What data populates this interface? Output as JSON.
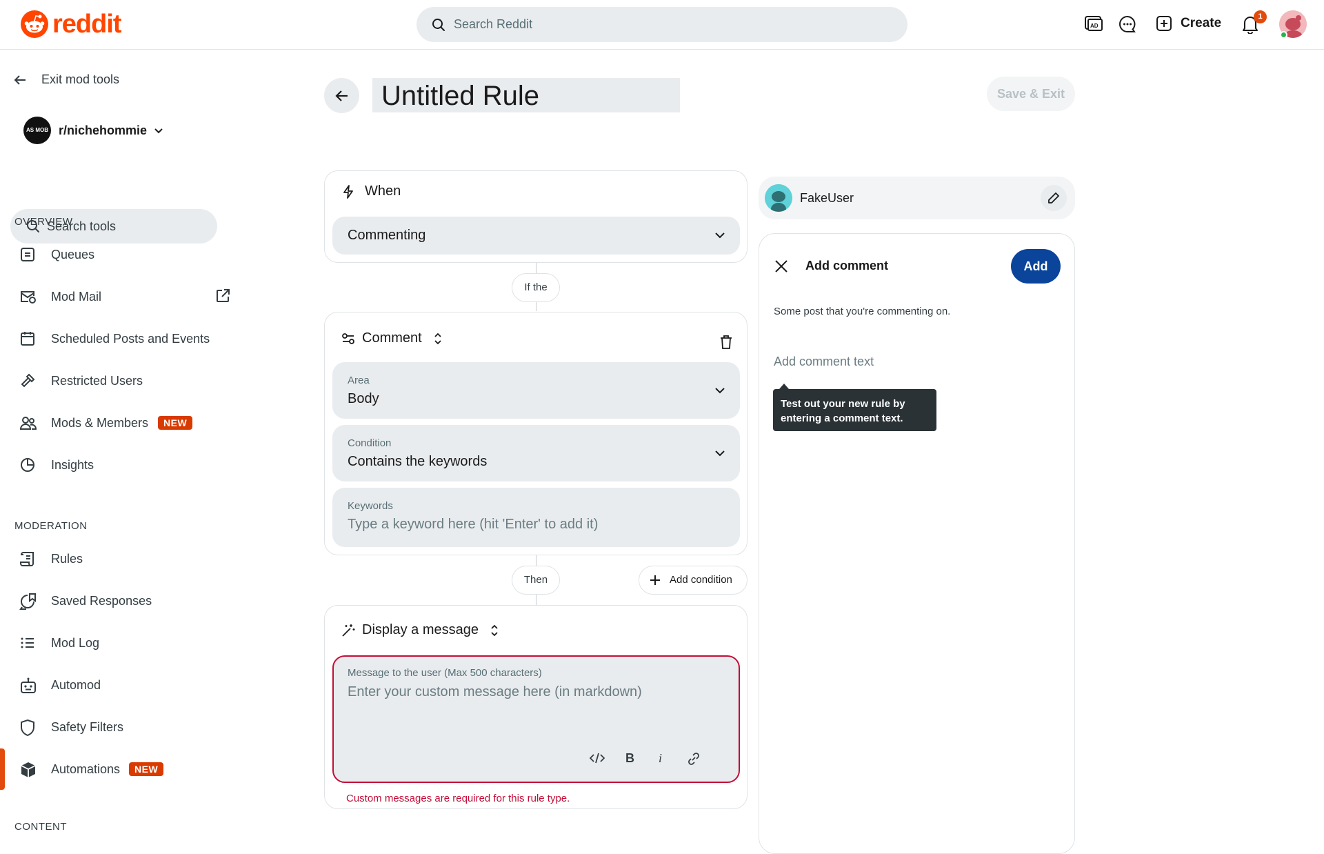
{
  "header": {
    "brand": "reddit",
    "search_placeholder": "Search Reddit",
    "create_label": "Create",
    "notification_count": "1",
    "icons": [
      "advertise-icon",
      "chat-icon",
      "create-plus-icon",
      "bell-icon"
    ]
  },
  "sidebar": {
    "exit_label": "Exit mod tools",
    "community": "r/nichehommie",
    "community_avatar_text": "AS MOB",
    "search_placeholder": "Search tools",
    "overview_title": "OVERVIEW",
    "overview_items": [
      {
        "label": "Queues",
        "icon": "queue-icon"
      },
      {
        "label": "Mod Mail",
        "icon": "mail-icon"
      },
      {
        "label": "Scheduled Posts and Events",
        "icon": "calendar-icon"
      },
      {
        "label": "Restricted Users",
        "icon": "gavel-icon"
      },
      {
        "label": "Mods & Members",
        "icon": "members-icon",
        "badge": "NEW"
      },
      {
        "label": "Insights",
        "icon": "chart-icon"
      }
    ],
    "moderation_title": "MODERATION",
    "moderation_items": [
      {
        "label": "Rules",
        "icon": "rules-icon"
      },
      {
        "label": "Saved Responses",
        "icon": "saved-responses-icon"
      },
      {
        "label": "Mod Log",
        "icon": "list-icon"
      },
      {
        "label": "Automod",
        "icon": "robot-icon"
      },
      {
        "label": "Safety Filters",
        "icon": "shield-icon"
      },
      {
        "label": "Automations",
        "icon": "cube-icon",
        "badge": "NEW",
        "active": true
      }
    ],
    "content_title": "CONTENT"
  },
  "editor": {
    "title": "Untitled Rule",
    "save_label": "Save & Exit",
    "when": {
      "heading": "When",
      "trigger": "Commenting"
    },
    "if_label": "If the",
    "condition": {
      "heading": "Comment",
      "area_label": "Area",
      "area_value": "Body",
      "condition_label": "Condition",
      "condition_value": "Contains the keywords",
      "keywords_label": "Keywords",
      "keywords_placeholder": "Type a keyword here (hit 'Enter' to add it)"
    },
    "then_label": "Then",
    "add_condition_label": "Add condition",
    "action": {
      "heading": "Display a message",
      "message_label": "Message to the user (Max 500 characters)",
      "message_placeholder": "Enter your custom message here (in markdown)",
      "error": "Custom messages are required for this rule type."
    },
    "colors": {
      "error": "#c20e37",
      "accent": "#0a449b",
      "brand": "#ff4500"
    }
  },
  "preview": {
    "username": "FakeUser",
    "panel_title": "Add comment",
    "add_label": "Add",
    "post_text": "Some post that you're commenting on.",
    "comment_placeholder": "Add comment text",
    "tooltip_line1": "Test out your new rule by",
    "tooltip_line2": "entering a comment text."
  }
}
